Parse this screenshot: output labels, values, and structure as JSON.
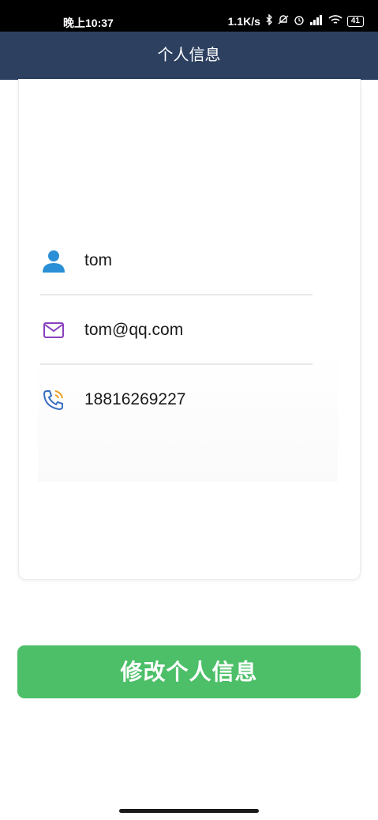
{
  "status_bar": {
    "time": "晚上10:37",
    "network_speed": "1.1K/s",
    "battery": "41",
    "icons": [
      "bluetooth-icon",
      "mute-icon",
      "alarm-icon",
      "signal-icon",
      "wifi-icon",
      "battery-icon"
    ]
  },
  "header": {
    "title": "个人信息"
  },
  "profile": {
    "username": "tom",
    "email": "tom@qq.com",
    "phone": "18816269227"
  },
  "actions": {
    "edit_label": "修改个人信息"
  },
  "colors": {
    "header_bg": "#2d4060",
    "button_bg": "#4cbf68",
    "user_icon": "#2a8fd6",
    "mail_icon": "#8a3fc0",
    "phone_icon": "#3a6fc0",
    "phone_waves": "#f0a020"
  }
}
